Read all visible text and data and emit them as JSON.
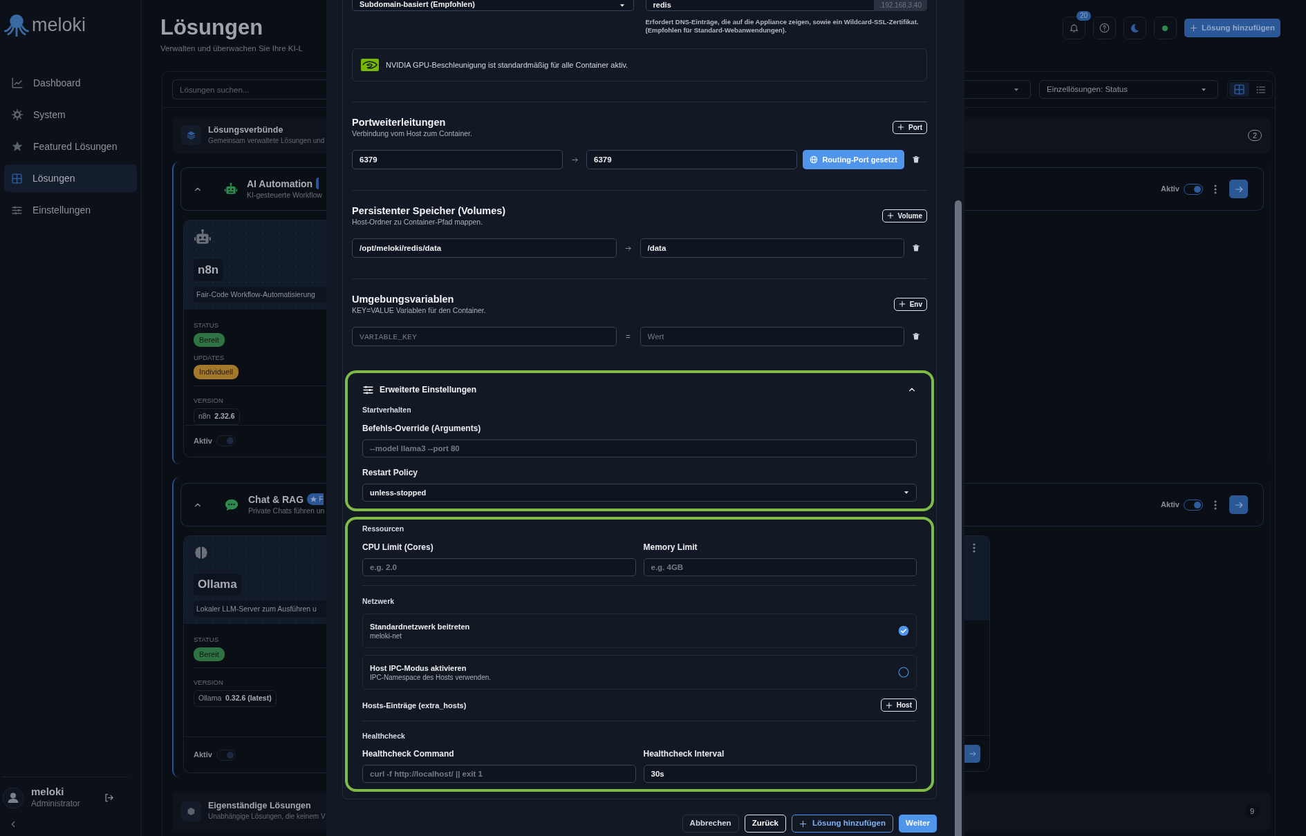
{
  "sidebar": {
    "brand": "meloki",
    "items": [
      {
        "label": "Dashboard",
        "selected": false
      },
      {
        "label": "System",
        "selected": false
      },
      {
        "label": "Featured Lösungen",
        "selected": false
      },
      {
        "label": "Lösungen",
        "selected": true
      },
      {
        "label": "Einstellungen",
        "selected": false
      }
    ],
    "user": {
      "name": "meloki",
      "role": "Administrator"
    }
  },
  "header": {
    "title": "Lösungen",
    "subtitle": "Verwalten und überwachen Sie Ihre KI-L",
    "notification_count": "20",
    "add_button": "Lösung hinzufügen"
  },
  "toolbar": {
    "search_placeholder": "Lösungen suchen...",
    "status_filter": "Einzellösungen: Status",
    "views": [
      {
        "selected": true
      },
      {
        "selected": false
      }
    ]
  },
  "bundles_section": {
    "title": "Lösungsverbünde",
    "subtitle": "Gemeinsam verwaltete Lösungen und",
    "count": "2"
  },
  "bundles": [
    {
      "name": "AI Automation",
      "description": "KI-gesteuerte Workflow",
      "badge": {
        "kind": "featured"
      },
      "expanded": true,
      "active_label": "Aktiv",
      "active": true,
      "second_card_visible": false,
      "card": {
        "name": "n8n",
        "description": "Fair-Code Workflow-Automatisierung",
        "facts": [
          {
            "label": "STATUS",
            "value": "Bereit",
            "kind": "success"
          },
          {
            "label": "UPDATES",
            "value": "Individuell",
            "kind": "warning"
          }
        ],
        "version_label": "VERSION",
        "version_app": "n8n",
        "version": "2.32.6",
        "active_label": "Aktiv",
        "active": true
      }
    },
    {
      "name": "Chat & RAG",
      "description": "Private Chats führen un",
      "badge": {
        "kind": "featured",
        "label": "F"
      },
      "expanded": true,
      "active_label": "Aktiv",
      "active": true,
      "second_card_visible": true,
      "card": {
        "name": "Ollama",
        "description": "Lokaler LLM-Server zum Ausführen u",
        "facts": [
          {
            "label": "STATUS",
            "value": "Bereit",
            "kind": "success"
          }
        ],
        "version_label": "VERSION",
        "version_app": "Ollama",
        "version": "0.32.6 (latest)",
        "active_label": "Aktiv",
        "active": true
      }
    }
  ],
  "standalone_section": {
    "title": "Eigenständige Lösungen",
    "subtitle": "Unabhängige Lösungen, die keinem V",
    "count": "9"
  },
  "modal": {
    "routing": {
      "mode": "Subdomain-basiert (Empfohlen)",
      "subdomain": "redis",
      "suffix": ".192.168.3.40",
      "help": "Erfordert DNS-Einträge, die auf die Appliance zeigen, sowie ein Wildcard-SSL-Zertifikat. (Empfohlen für Standard-Webanwendungen)."
    },
    "gpu_notice": "NVIDIA GPU-Beschleunigung ist standardmäßig für alle Container aktiv.",
    "ports": {
      "title": "Portweiterleitungen",
      "subtitle": "Verbindung vom Host zum Container.",
      "add_label": "Port",
      "rows": [
        {
          "host": "6379",
          "container": "6379",
          "routing_label": "Routing-Port gesetzt",
          "routing": true
        }
      ]
    },
    "volumes": {
      "title": "Persistenter Speicher (Volumes)",
      "subtitle": "Host-Ordner zu Container-Pfad mappen.",
      "add_label": "Volume",
      "rows": [
        {
          "host": "/opt/meloki/redis/data",
          "container": "/data"
        }
      ]
    },
    "env": {
      "title": "Umgebungsvariablen",
      "subtitle": "KEY=VALUE Variablen für den Container.",
      "add_label": "Env",
      "rows": [
        {
          "key_placeholder": "VARIABLE_KEY",
          "separator": "=",
          "value_placeholder": "Wert"
        }
      ]
    },
    "advanced": {
      "title": "Erweiterte Einstellungen",
      "expanded": true,
      "highlighted": true,
      "startup_heading": "Startverhalten",
      "command_label": "Befehls-Override (Arguments)",
      "command_placeholder": "--model llama3 --port 80",
      "restart_label": "Restart Policy",
      "restart_value": "unless-stopped"
    },
    "resources": {
      "highlighted": true,
      "heading": "Ressourcen",
      "cpu_label": "CPU Limit (Cores)",
      "cpu_placeholder": "e.g. 2.0",
      "memory_label": "Memory Limit",
      "memory_placeholder": "e.g. 4GB",
      "network_heading": "Netzwerk",
      "network_options": [
        {
          "title": "Standardnetzwerk beitreten",
          "subtitle": "meloki-net",
          "checked": true
        },
        {
          "title": "Host IPC-Modus aktivieren",
          "subtitle": "IPC-Namespace des Hosts verwenden.",
          "checked": false
        }
      ],
      "hosts_label": "Hosts-Einträge (extra_hosts)",
      "hosts_add": "Host",
      "health_heading": "Healthcheck",
      "health_command_label": "Healthcheck Command",
      "health_command_placeholder": "curl -f http://localhost/ || exit 1",
      "health_interval_label": "Healthcheck Interval",
      "health_interval_value": "30s"
    },
    "footer": [
      {
        "label": "Abbrechen",
        "kind": "cancel"
      },
      {
        "label": "Zurück",
        "kind": "back"
      },
      {
        "label": "Lösung hinzufügen",
        "kind": "add"
      },
      {
        "label": "Weiter",
        "kind": "primary"
      }
    ]
  }
}
